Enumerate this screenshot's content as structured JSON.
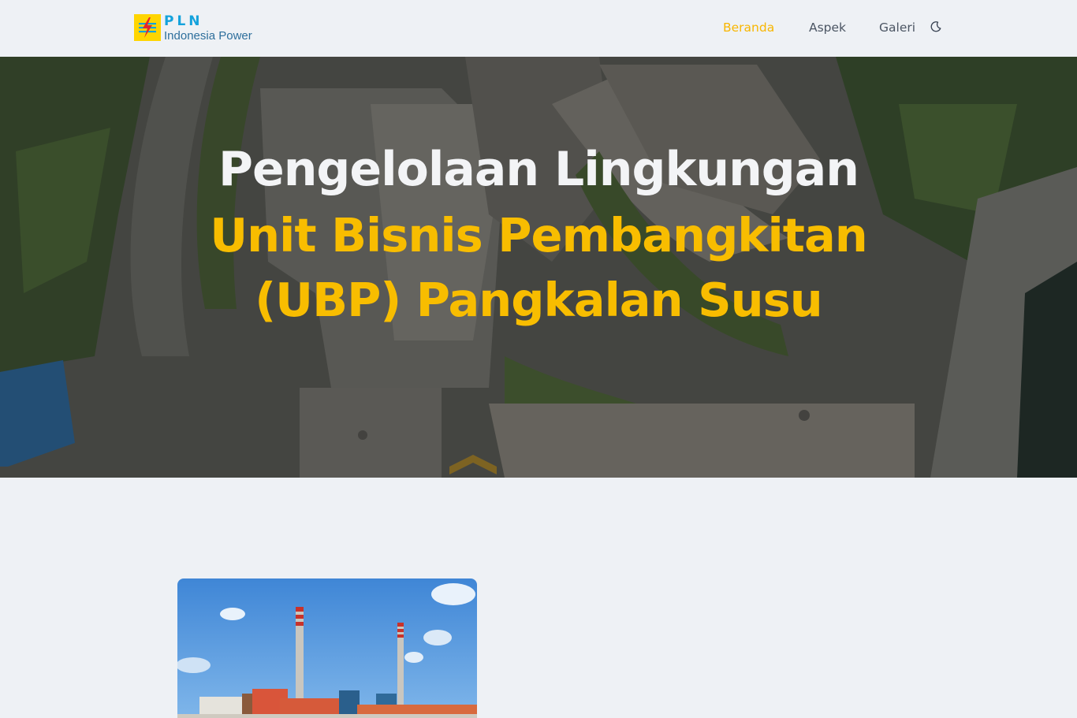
{
  "brand": {
    "name": "PLN",
    "subtitle": "Indonesia Power"
  },
  "nav": {
    "items": [
      {
        "label": "Beranda",
        "active": true
      },
      {
        "label": "Aspek",
        "active": false
      },
      {
        "label": "Galeri",
        "active": false
      }
    ],
    "theme_toggle_icon": "moon-icon"
  },
  "hero": {
    "title_line1": "Pengelolaan Lingkungan",
    "title_line2": "Unit Bisnis Pembangkitan",
    "title_line3": "(UBP) Pangkalan Susu"
  },
  "colors": {
    "accent": "#f8b600",
    "hero_white": "#f3f4f6",
    "page_background": "#eef1f5",
    "logo_yellow": "#ffd500",
    "logo_blue": "#14a2dc"
  }
}
